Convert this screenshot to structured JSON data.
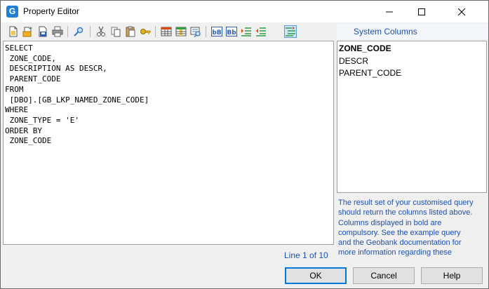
{
  "window": {
    "title": "Property Editor",
    "app_icon_letter": "G"
  },
  "toolbar": {
    "buttons": [
      {
        "icon": "new-file-icon"
      },
      {
        "icon": "open-folder-icon"
      },
      {
        "icon": "save-as-icon"
      },
      {
        "icon": "print-icon"
      },
      {
        "icon": "find-icon"
      },
      {
        "icon": "cut-icon"
      },
      {
        "icon": "copy-icon"
      },
      {
        "icon": "paste-icon"
      },
      {
        "icon": "key-icon"
      },
      {
        "icon": "table-icon"
      },
      {
        "icon": "table-columns-icon"
      },
      {
        "icon": "query-preview-icon"
      },
      {
        "icon": "lowercase-icon",
        "label": "bB"
      },
      {
        "icon": "uppercase-icon",
        "label": "Bb"
      },
      {
        "icon": "indent-icon"
      },
      {
        "icon": "outdent-icon"
      },
      {
        "icon": "format-sql-icon",
        "active": true
      }
    ]
  },
  "editor": {
    "lines": [
      "SELECT",
      " ZONE_CODE,",
      " DESCRIPTION AS DESCR,",
      " PARENT_CODE",
      "FROM",
      " [DBO].[GB_LKP_NAMED_ZONE_CODE]",
      "WHERE",
      " ZONE_TYPE = 'E'",
      "ORDER BY",
      " ZONE_CODE"
    ],
    "status": "Line 1 of 10"
  },
  "system_columns": {
    "title": "System Columns",
    "items": [
      {
        "label": "ZONE_CODE",
        "bold": true
      },
      {
        "label": "DESCR",
        "bold": false
      },
      {
        "label": "PARENT_CODE",
        "bold": false
      }
    ],
    "info": [
      "The result set of your customised query",
      "should return the columns listed above.",
      "Columns displayed in bold are",
      "compulsory. See the example query",
      "and the Geobank documentation for",
      "more information regarding these"
    ]
  },
  "buttons": {
    "ok": "OK",
    "cancel": "Cancel",
    "help": "Help"
  },
  "colors": {
    "accent": "#0078d7",
    "info_text": "#1d4fb8",
    "app_icon": "#1f7fd6"
  }
}
